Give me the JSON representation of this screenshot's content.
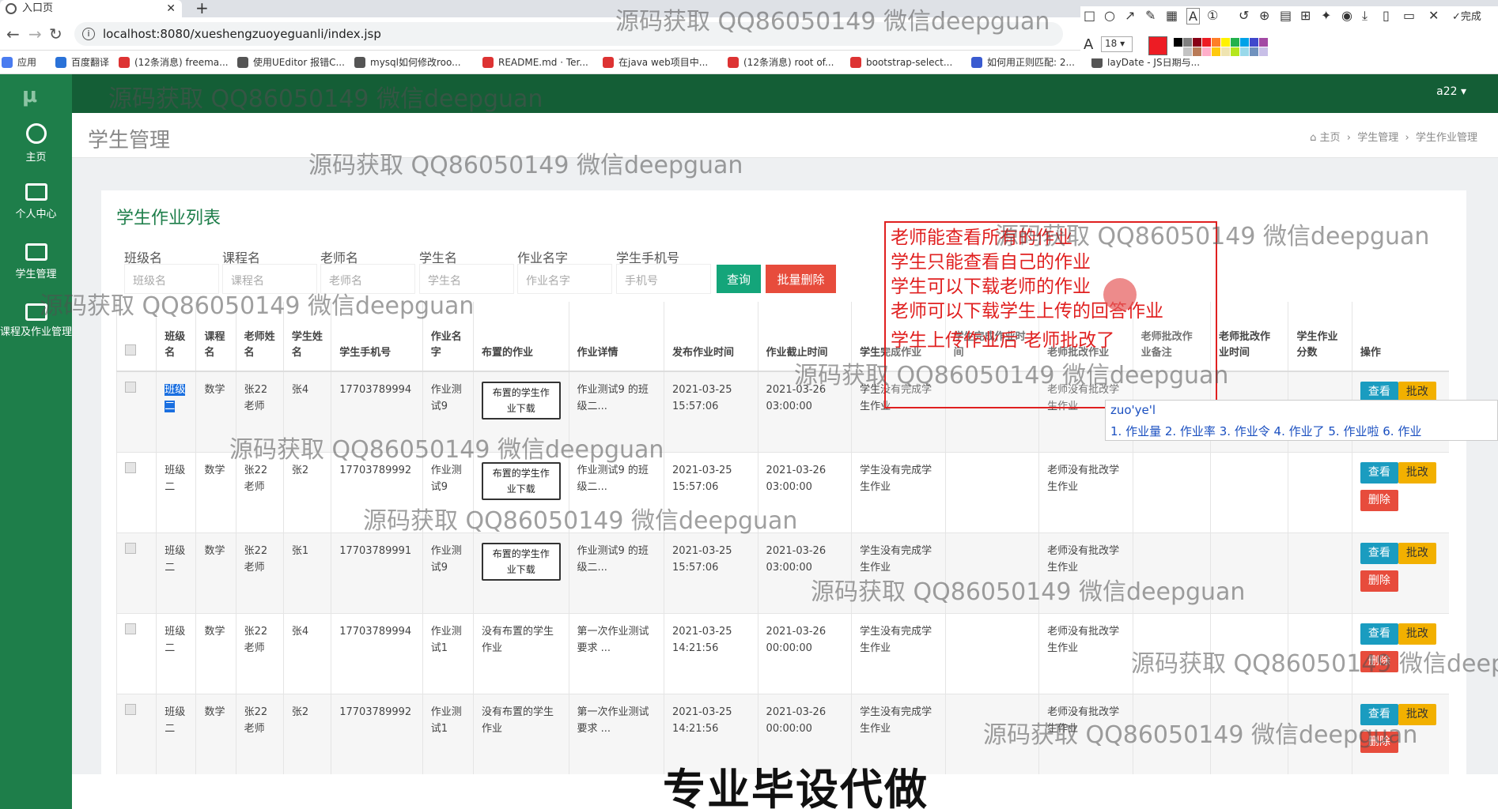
{
  "browser": {
    "tab_title": "入口页",
    "url": "localhost:8080/xueshengzuoyeguanli/index.jsp",
    "bookmarks": [
      "应用",
      "百度翻译",
      "(12条消息) freema...",
      "使用UEditor 报错C...",
      "mysql如何修改roo...",
      "README.md · Ter...",
      "在java web项目中...",
      "(12条消息) root of...",
      "bootstrap-select...",
      "如何用正则匹配: 2...",
      "layDate - JS日期与..."
    ]
  },
  "screen_toolbar": {
    "font_label": "A",
    "font_size": "18",
    "done_label": "完成",
    "colors": [
      "#000000",
      "#7f7f7f",
      "#880015",
      "#ed1c24",
      "#ff7f27",
      "#fff200",
      "#22b14c",
      "#00a2e8",
      "#3f48cc",
      "#a349a4",
      "#ffffff",
      "#c3c3c3",
      "#b97a57",
      "#ffaec9",
      "#ffc90e",
      "#efe4b0",
      "#b5e61d",
      "#99d9ea",
      "#7092be",
      "#c8bfe7"
    ],
    "selected_color": "#ed1c24"
  },
  "app": {
    "logo": "μ",
    "user": "a22 ▾",
    "sidebar": [
      {
        "label": "主页",
        "icon": "dashboard-icon"
      },
      {
        "label": "个人中心",
        "icon": "monitor-icon"
      },
      {
        "label": "学生管理",
        "icon": "monitor-icon"
      },
      {
        "label": "课程及作业管理",
        "icon": "monitor-icon"
      }
    ],
    "page_title": "学生管理",
    "breadcrumb": [
      "主页",
      "学生管理",
      "学生作业管理"
    ]
  },
  "list": {
    "title": "学生作业列表",
    "filters": [
      {
        "label": "班级名",
        "placeholder": "班级名"
      },
      {
        "label": "课程名",
        "placeholder": "课程名"
      },
      {
        "label": "老师名",
        "placeholder": "老师名"
      },
      {
        "label": "学生名",
        "placeholder": "学生名"
      },
      {
        "label": "作业名字",
        "placeholder": "作业名字"
      },
      {
        "label": "学生手机号",
        "placeholder": "手机号"
      }
    ],
    "query_label": "查询",
    "batch_delete_label": "批量删除",
    "columns": [
      "班级名",
      "课程名",
      "老师姓名",
      "学生姓名",
      "学生手机号",
      "作业名字",
      "布置的作业",
      "作业详情",
      "发布作业时间",
      "作业截止时间",
      "学生完成作业",
      "学生完成作业时间",
      "老师批改作业",
      "老师批改作业备注",
      "老师批改作业时间",
      "学生作业分数",
      "操作"
    ],
    "download_label": "布置的学生作业下载",
    "view_label": "查看",
    "edit_label": "批改",
    "delete_label": "删除",
    "rows": [
      {
        "cls": "班级二",
        "course": "数学",
        "teacher": "张22老师",
        "student": "张4",
        "phone": "17703789994",
        "hw": "作业测试9",
        "assigned": "download",
        "detail": "作业测试9 的班级二...",
        "pub": "2021-03-25 15:57:06",
        "due": "2021-03-26 03:00:00",
        "done": "学生没有完成学生作业",
        "done_time": "",
        "graded": "老师没有批改学生作业",
        "note": "",
        "grade_time": "",
        "score": "",
        "selected": true
      },
      {
        "cls": "班级二",
        "course": "数学",
        "teacher": "张22老师",
        "student": "张2",
        "phone": "17703789992",
        "hw": "作业测试9",
        "assigned": "download",
        "detail": "作业测试9 的班级二...",
        "pub": "2021-03-25 15:57:06",
        "due": "2021-03-26 03:00:00",
        "done": "学生没有完成学生作业",
        "done_time": "",
        "graded": "老师没有批改学生作业",
        "note": "",
        "grade_time": "",
        "score": ""
      },
      {
        "cls": "班级二",
        "course": "数学",
        "teacher": "张22老师",
        "student": "张1",
        "phone": "17703789991",
        "hw": "作业测试9",
        "assigned": "download",
        "detail": "作业测试9 的班级二...",
        "pub": "2021-03-25 15:57:06",
        "due": "2021-03-26 03:00:00",
        "done": "学生没有完成学生作业",
        "done_time": "",
        "graded": "老师没有批改学生作业",
        "note": "",
        "grade_time": "",
        "score": ""
      },
      {
        "cls": "班级二",
        "course": "数学",
        "teacher": "张22老师",
        "student": "张4",
        "phone": "17703789994",
        "hw": "作业测试1",
        "assigned": "没有布置的学生作业",
        "detail": "第一次作业测试要求 ...",
        "pub": "2021-03-25 14:21:56",
        "due": "2021-03-26 00:00:00",
        "done": "学生没有完成学生作业",
        "done_time": "",
        "graded": "老师没有批改学生作业",
        "note": "",
        "grade_time": "",
        "score": ""
      },
      {
        "cls": "班级二",
        "course": "数学",
        "teacher": "张22老师",
        "student": "张2",
        "phone": "17703789992",
        "hw": "作业测试1",
        "assigned": "没有布置的学生作业",
        "detail": "第一次作业测试要求 ...",
        "pub": "2021-03-25 14:21:56",
        "due": "2021-03-26 00:00:00",
        "done": "学生没有完成学生作业",
        "done_time": "",
        "graded": "老师没有批改学生作业",
        "note": "",
        "grade_time": "",
        "score": ""
      }
    ]
  },
  "annotation": [
    "老师能查看所有的作业",
    "学生只能查看自己的作业",
    "学生可以下载老师的作业",
    "老师可以下载学生上传的回答作业",
    "学生上传作业后 老师批改了"
  ],
  "ime": {
    "input": "zuo'ye'l",
    "candidates": "1. 作业量   2. 作业率   3. 作业令   4. 作业了   5. 作业啦   6. 作业"
  },
  "watermark": "源码获取 QQ86050149 微信deepguan",
  "banner": "专业毕设代做"
}
